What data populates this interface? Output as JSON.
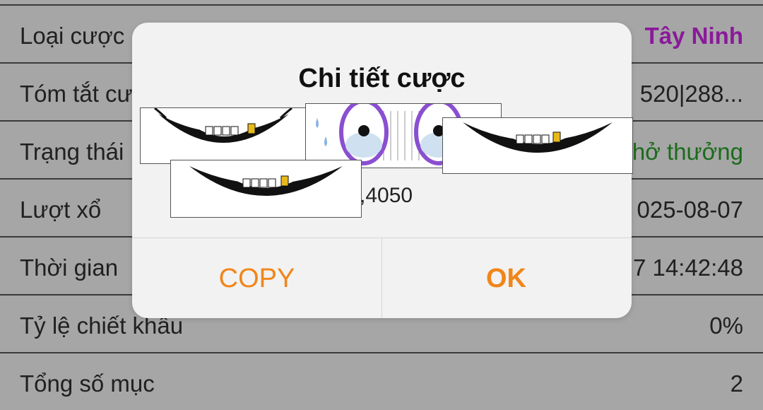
{
  "rows": [
    {
      "label": "Loại cược",
      "value": "Tây Ninh"
    },
    {
      "label": "Tóm tắt cược",
      "value": "520|288..."
    },
    {
      "label": "Trạng thái",
      "value": "hở thưởng"
    },
    {
      "label": "Lượt xổ",
      "value": "025-08-07"
    },
    {
      "label": "Thời gian",
      "value": "7 14:42:48"
    },
    {
      "label": "Tỷ lệ chiết khấu",
      "value": "0%"
    },
    {
      "label": "Tổng số mục",
      "value": "2"
    }
  ],
  "dialog": {
    "title": "Chi tiết cược",
    "body_fragment": ",4050",
    "copy_label": "COPY",
    "ok_label": "OK"
  },
  "colors": {
    "accent": "#f0861a",
    "purple": "#8a1a9a",
    "green": "#1b6b1b"
  },
  "stickers": [
    "smile-sticker",
    "eyes-sticker",
    "smile-sticker",
    "smile-sticker"
  ]
}
